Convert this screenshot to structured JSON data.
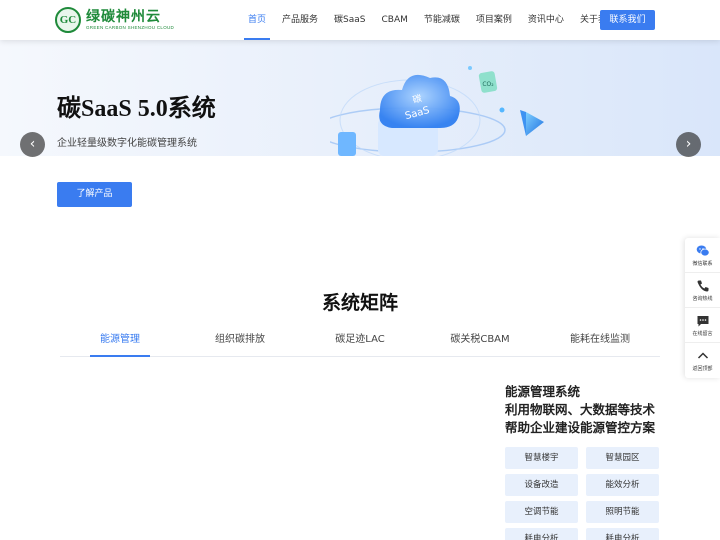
{
  "brand": {
    "mark": "GC",
    "name_cn": "绿碳神州云",
    "name_en": "GREEN CARBON SHENZHOU CLOUD",
    "color": "#1f8a3a"
  },
  "nav": {
    "items": [
      {
        "label": "首页",
        "active": true
      },
      {
        "label": "产品服务",
        "active": false
      },
      {
        "label": "碳SaaS",
        "active": false
      },
      {
        "label": "CBAM",
        "active": false
      },
      {
        "label": "节能减碳",
        "active": false
      },
      {
        "label": "项目案例",
        "active": false
      },
      {
        "label": "资讯中心",
        "active": false
      },
      {
        "label": "关于我们",
        "active": false
      }
    ],
    "contact_label": "联系我们"
  },
  "banner": {
    "title": "碳SaaS 5.0系统",
    "subtitle": "企业轻量级数字化能碳管理系统",
    "cloud_label_top": "碳",
    "cloud_label_bottom": "SaaS",
    "badge_label": "CO₂",
    "prev_icon": "chevron-left-icon",
    "next_icon": "chevron-right-icon"
  },
  "cta": {
    "label": "了解产品"
  },
  "matrix": {
    "title": "系统矩阵",
    "tabs": [
      {
        "label": "能源管理",
        "active": true
      },
      {
        "label": "组织碳排放",
        "active": false
      },
      {
        "label": "碳足迹LAC",
        "active": false
      },
      {
        "label": "碳关税CBAM",
        "active": false
      },
      {
        "label": "能耗在线监测",
        "active": false
      }
    ],
    "panel": {
      "heading_lines": [
        "能源管理系统",
        "利用物联网、大数据等技术",
        "帮助企业建设能源管控方案"
      ],
      "tags": [
        "智慧楼宇",
        "智慧园区",
        "设备改造",
        "能效分析",
        "空调节能",
        "照明节能",
        "耗电分析",
        "耗电分析"
      ]
    }
  },
  "sidebar": {
    "items": [
      {
        "label": "微信联系",
        "icon": "wechat-icon"
      },
      {
        "label": "咨询热线",
        "icon": "phone-icon"
      },
      {
        "label": "在线留言",
        "icon": "message-icon"
      },
      {
        "label": "返回顶部",
        "icon": "arrow-up-icon"
      }
    ]
  },
  "colors": {
    "accent": "#3a7cf0",
    "tag_bg": "#e8f0fc"
  }
}
